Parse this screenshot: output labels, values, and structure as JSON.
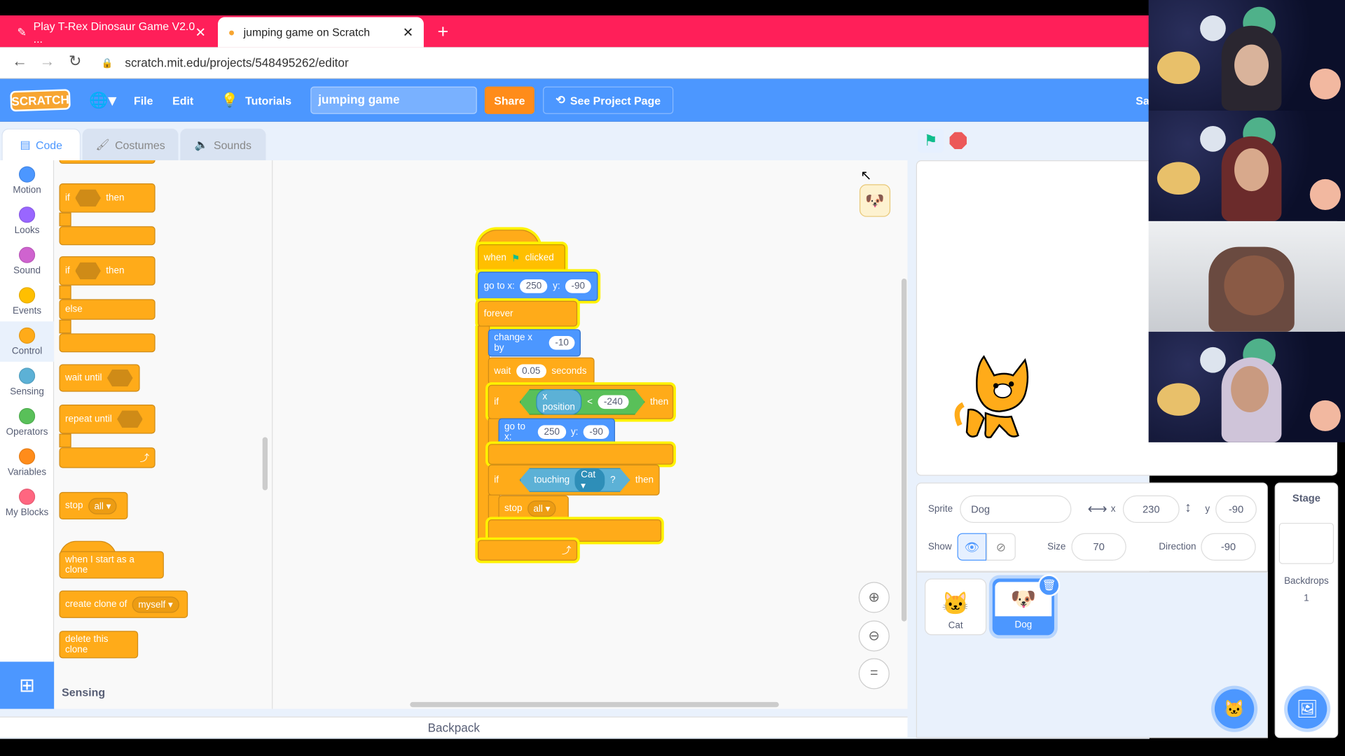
{
  "browser": {
    "tabs": [
      {
        "label": "Play T-Rex Dinosaur Game V2.0 ...",
        "active": false
      },
      {
        "label": "jumping game on Scratch",
        "active": true
      }
    ],
    "url": "scratch.mit.edu/projects/548495262/editor"
  },
  "menu": {
    "logo": "SCRATCH",
    "file": "File",
    "edit": "Edit",
    "tutorials": "Tutorials",
    "project_title": "jumping game",
    "share": "Share",
    "see_project_page": "See Project Page",
    "cut_text": "Sa"
  },
  "editor_tabs": {
    "code": "Code",
    "costumes": "Costumes",
    "sounds": "Sounds"
  },
  "categories": [
    {
      "label": "Motion",
      "color": "#4c97ff"
    },
    {
      "label": "Looks",
      "color": "#9966ff"
    },
    {
      "label": "Sound",
      "color": "#cf63cf"
    },
    {
      "label": "Events",
      "color": "#ffbf00"
    },
    {
      "label": "Control",
      "color": "#ffab19"
    },
    {
      "label": "Sensing",
      "color": "#5cb1d6"
    },
    {
      "label": "Operators",
      "color": "#59c059"
    },
    {
      "label": "Variables",
      "color": "#ff8c1a"
    },
    {
      "label": "My Blocks",
      "color": "#ff6680"
    }
  ],
  "palette": {
    "if_label": "if",
    "then_label": "then",
    "else_label": "else",
    "wait_until": "wait until",
    "repeat_until": "repeat until",
    "stop": "stop",
    "stop_option": "all",
    "when_clone": "when I start as a clone",
    "create_clone": "create clone of",
    "create_clone_option": "myself",
    "delete_clone": "delete this clone",
    "section_label": "Sensing"
  },
  "script": {
    "hat_when": "when",
    "hat_clicked": "clicked",
    "goto_label": "go to x:",
    "y_label": "y:",
    "goto1_x": "250",
    "goto1_y": "-90",
    "forever": "forever",
    "change_x": "change x by",
    "change_x_val": "-10",
    "wait": "wait",
    "wait_val": "0.05",
    "seconds": "seconds",
    "if1": "if",
    "xpos": "x position",
    "lt": "<",
    "cmp_val": "-240",
    "then1": "then",
    "goto2_x": "250",
    "goto2_y": "-90",
    "if2": "if",
    "touching": "touching",
    "touch_target": "Cat",
    "question": "?",
    "then2": "then",
    "stop": "stop",
    "stop_val": "all"
  },
  "backpack": "Backpack",
  "sprite_info": {
    "sprite_label": "Sprite",
    "sprite_name": "Dog",
    "x_label": "x",
    "x_val": "230",
    "y_label": "y",
    "y_val": "-90",
    "show_label": "Show",
    "size_label": "Size",
    "size_val": "70",
    "direction_label": "Direction",
    "direction_val": "-90"
  },
  "sprites": [
    {
      "name": "Cat",
      "selected": false
    },
    {
      "name": "Dog",
      "selected": true
    }
  ],
  "stage_pane": {
    "title": "Stage",
    "backdrops_label": "Backdrops",
    "backdrops_count": "1"
  }
}
